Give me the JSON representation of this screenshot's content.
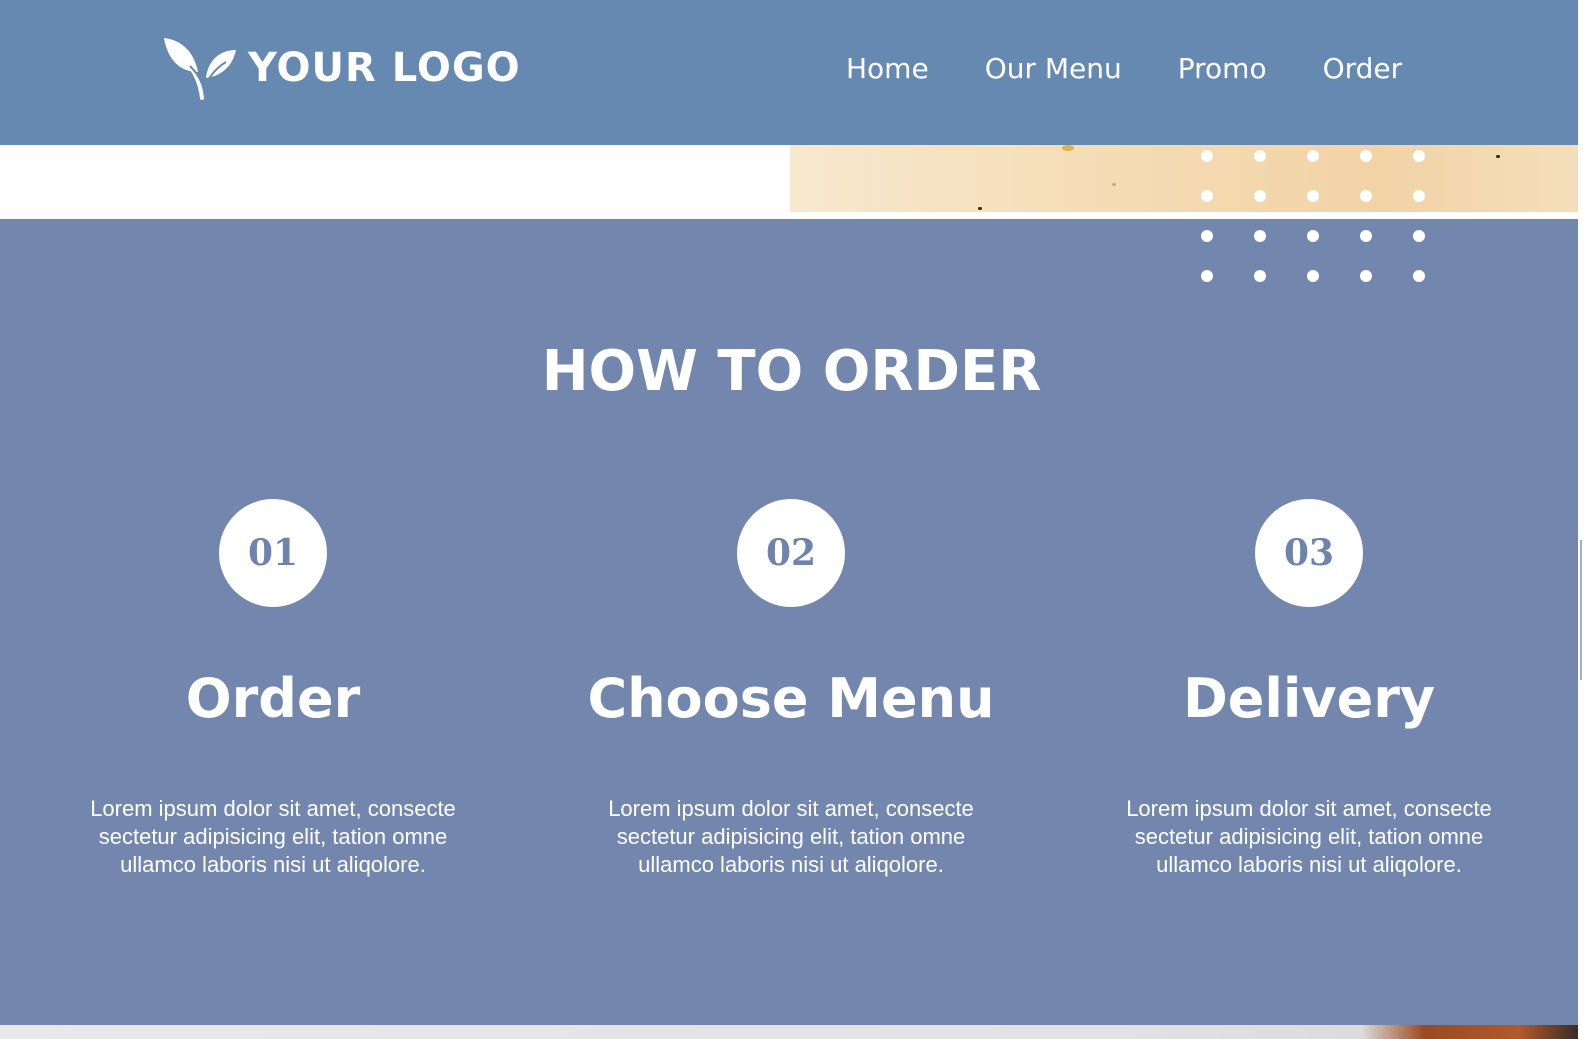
{
  "header": {
    "logo_text": "YOUR LOGO",
    "logo_icon": "leaf-icon",
    "nav": [
      "Home",
      "Our Menu",
      "Promo",
      "Order"
    ]
  },
  "section": {
    "title": "HOW TO ORDER",
    "steps": [
      {
        "number": "01",
        "title": "Order",
        "text": "Lorem ipsum dolor sit amet, consecte sectetur adipisicing elit, tation omne ullamco laboris nisi ut aliqolore."
      },
      {
        "number": "02",
        "title": "Choose Menu",
        "text": "Lorem ipsum dolor sit amet, consecte sectetur adipisicing elit, tation omne ullamco laboris nisi ut aliqolore."
      },
      {
        "number": "03",
        "title": "Delivery",
        "text": "Lorem ipsum dolor sit amet, consecte sectetur adipisicing elit, tation omne ullamco laboris nisi ut aliqolore."
      }
    ]
  },
  "colors": {
    "header_bg": "#6689b2",
    "section_bg": "#7387ae",
    "circle_text": "#6f84ad",
    "text": "#ffffff"
  }
}
